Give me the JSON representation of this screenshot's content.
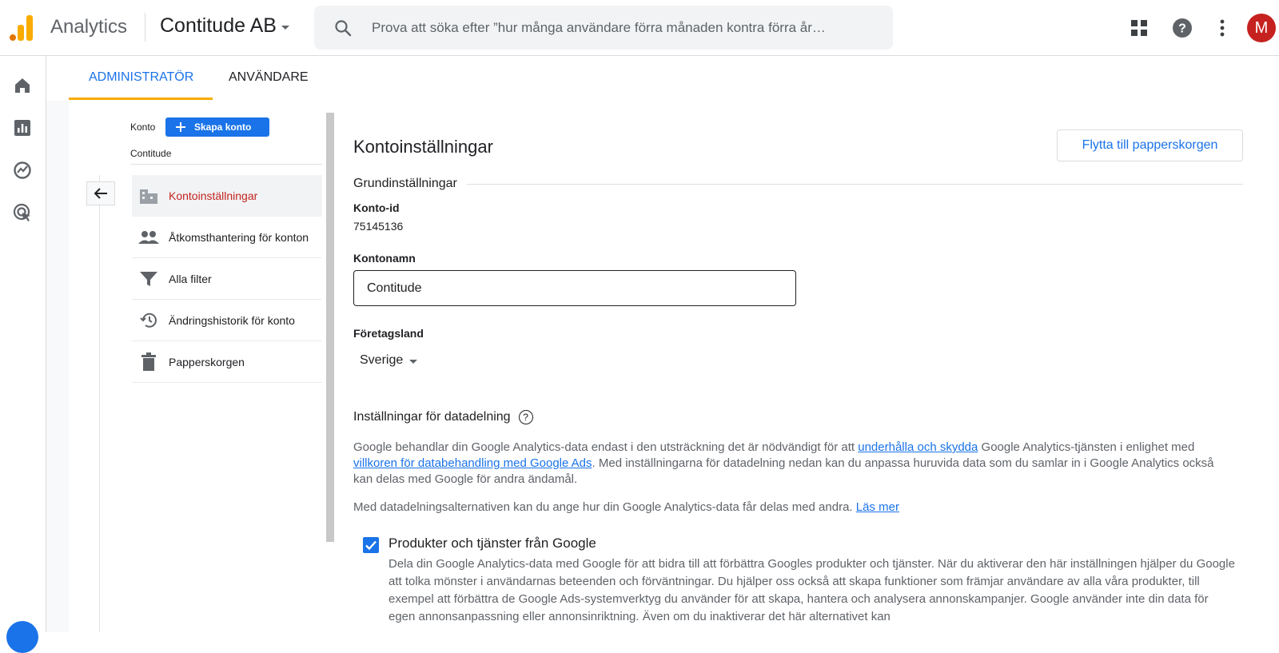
{
  "header": {
    "app_name": "Analytics",
    "account": "Contitude AB",
    "search_placeholder": "Prova att söka efter ”hur många användare förra månaden kontra förra år…",
    "avatar_initial": "M"
  },
  "tabs": [
    {
      "label": "ADMINISTRATÖR",
      "active": true
    },
    {
      "label": "ANVÄNDARE",
      "active": false
    }
  ],
  "sidebar": {
    "konto_label": "Konto",
    "create_button": "Skapa konto",
    "account_name": "Contitude",
    "items": [
      {
        "label": "Kontoinställningar",
        "icon": "building-icon",
        "active": true
      },
      {
        "label": "Åtkomsthantering för konton",
        "icon": "people-icon",
        "active": false
      },
      {
        "label": "Alla filter",
        "icon": "filter-icon",
        "active": false
      },
      {
        "label": "Ändringshistorik för konto",
        "icon": "history-icon",
        "active": false
      },
      {
        "label": "Papperskorgen",
        "icon": "trash-icon",
        "active": false
      }
    ]
  },
  "main": {
    "title": "Kontoinställningar",
    "trash_button": "Flytta till papperskorgen",
    "section_basic": "Grundinställningar",
    "account_id_label": "Konto-id",
    "account_id_value": "75145136",
    "account_name_label": "Kontonamn",
    "account_name_value": "Contitude",
    "country_label": "Företagsland",
    "country_value": "Sverige",
    "data_sharing_title": "Inställningar för datadelning",
    "para1_a": "Google behandlar din Google Analytics-data endast i den utsträckning det är nödvändigt för att ",
    "para1_link1": "underhålla och skydda",
    "para1_b": " Google Analytics-tjänsten i enlighet med ",
    "para1_link2": "villkoren för databehandling med Google Ads",
    "para1_c": ". Med inställningarna för datadelning nedan kan du anpassa huruvida data som du samlar in i Google Analytics också kan delas med Google för andra ändamål.",
    "para2_a": "Med datadelningsalternativen kan du ange hur din Google Analytics-data får delas med andra. ",
    "para2_link": "Läs mer",
    "checkbox_title": "Produkter och tjänster från Google",
    "checkbox_checked": true,
    "checkbox_desc": "Dela din Google Analytics-data med Google för att bidra till att förbättra Googles produkter och tjänster. När du aktiverar den här inställningen hjälper du Google att tolka mönster i användarnas beteenden och förväntningar. Du hjälper oss också att skapa funktioner som främjar användare av alla våra produkter, till exempel att förbättra de Google Ads-systemverktyg du använder för att skapa, hantera och analysera annonskampanjer. Google använder inte din data för egen annonsanpassning eller annonsinriktning. Även om du inaktiverar det här alternativet kan"
  },
  "colors": {
    "accent": "#1a73e8",
    "active_nav": "#c5221f",
    "tab_underline": "#f9ab00",
    "avatar": "#c5221f"
  }
}
